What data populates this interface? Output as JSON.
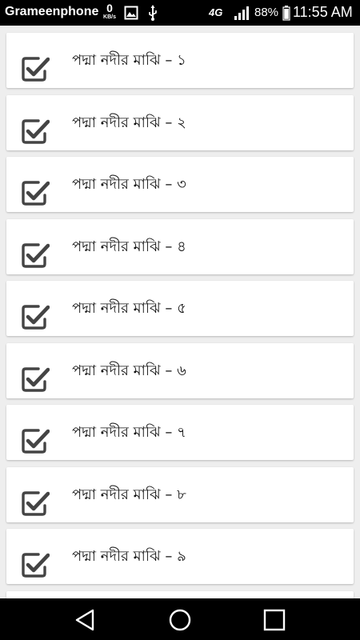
{
  "status_bar": {
    "carrier": "Grameenphone",
    "speed_value": "0",
    "speed_unit": "KB/s",
    "network": "4G",
    "battery_percent": "88%",
    "time": "11:55 AM",
    "icons": [
      "image-icon",
      "usb-icon",
      "signal-icon",
      "battery-icon"
    ]
  },
  "list": {
    "items": [
      {
        "label": "পদ্মা নদীর মাঝি – ১",
        "checked": true
      },
      {
        "label": "পদ্মা নদীর মাঝি – ২",
        "checked": true
      },
      {
        "label": "পদ্মা নদীর মাঝি – ৩",
        "checked": true
      },
      {
        "label": "পদ্মা নদীর মাঝি – ৪",
        "checked": true
      },
      {
        "label": "পদ্মা নদীর মাঝি – ৫",
        "checked": true
      },
      {
        "label": "পদ্মা নদীর মাঝি – ৬",
        "checked": true
      },
      {
        "label": "পদ্মা নদীর মাঝি – ৭",
        "checked": true
      },
      {
        "label": "পদ্মা নদীর মাঝি – ৮",
        "checked": true
      },
      {
        "label": "পদ্মা নদীর মাঝি – ৯",
        "checked": true
      }
    ]
  },
  "nav_bar": {
    "buttons": [
      "back-icon",
      "home-icon",
      "recents-icon"
    ]
  },
  "colors": {
    "status_bar_bg": "#000000",
    "list_bg": "#eeeeee",
    "card_bg": "#ffffff",
    "check_icon": "#444444"
  }
}
